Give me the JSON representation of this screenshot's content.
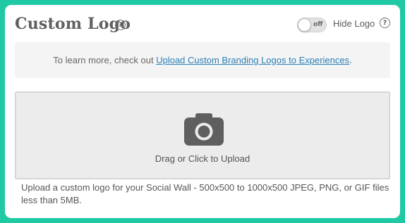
{
  "header": {
    "title": "Custom Logo",
    "title_help": "?",
    "toggle_state": "off",
    "hide_logo_label": "Hide Logo",
    "hide_help": "?"
  },
  "info": {
    "prefix": "To learn more, check out ",
    "link_text": "Upload Custom Branding Logos to Experiences",
    "suffix": "."
  },
  "upload": {
    "icon": "camera-icon",
    "label": "Drag or Click to Upload"
  },
  "description": "Upload a custom logo for your Social Wall - 500x500 to 1000x500 JPEG, PNG, or GIF files less than 5MB.",
  "colors": {
    "background": "#1ec9a3",
    "link": "#2a7fb5",
    "icon": "#5f5f5f"
  }
}
